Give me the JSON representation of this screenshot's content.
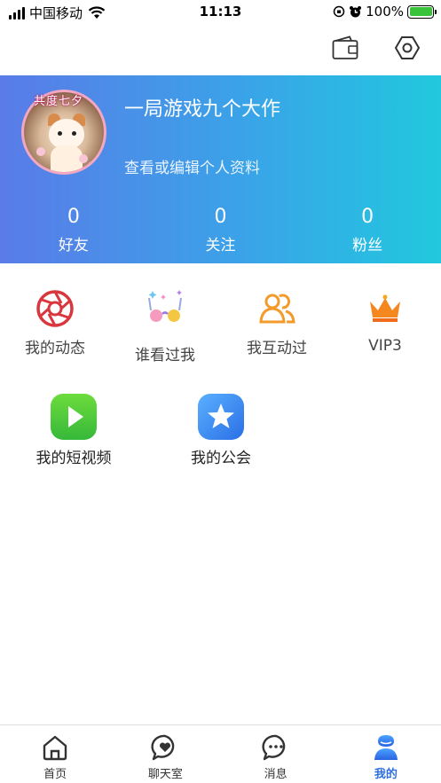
{
  "status_bar": {
    "carrier": "中国移动",
    "time": "11:13",
    "battery_percent": "100%",
    "battery_level": 1.0
  },
  "top_actions": {
    "wallet_icon": "wallet-icon",
    "settings_icon": "hexagon-settings-icon"
  },
  "profile": {
    "avatar_badge": "共度七夕",
    "nickname": "一局游戏九个大作",
    "edit_link": "查看或编辑个人资料",
    "banner_colors": [
      "#5a7be8",
      "#21c8de"
    ]
  },
  "stats": [
    {
      "value": "0",
      "label": "好友"
    },
    {
      "value": "0",
      "label": "关注"
    },
    {
      "value": "0",
      "label": "粉丝"
    }
  ],
  "features": [
    {
      "label": "我的动态",
      "icon": "aperture-icon",
      "color": "#d9363e"
    },
    {
      "label": "谁看过我",
      "icon": "glasses-icon",
      "color": "#f06aa8"
    },
    {
      "label": "我互动过",
      "icon": "users-icon",
      "color": "#f39a2b"
    },
    {
      "label": "VIP3",
      "icon": "crown-icon",
      "color": "#f5871f"
    },
    {
      "label": "我的短视频",
      "icon": "play-icon",
      "color": "#4cc93a"
    },
    {
      "label": "我的公会",
      "icon": "star-icon",
      "color": "#3a8ef0"
    }
  ],
  "tabbar": [
    {
      "label": "首页",
      "icon": "home-icon",
      "active": false
    },
    {
      "label": "聊天室",
      "icon": "chat-heart-icon",
      "active": false
    },
    {
      "label": "消息",
      "icon": "message-icon",
      "active": false
    },
    {
      "label": "我的",
      "icon": "profile-icon",
      "active": true
    }
  ],
  "accent_color": "#2f6fe0"
}
